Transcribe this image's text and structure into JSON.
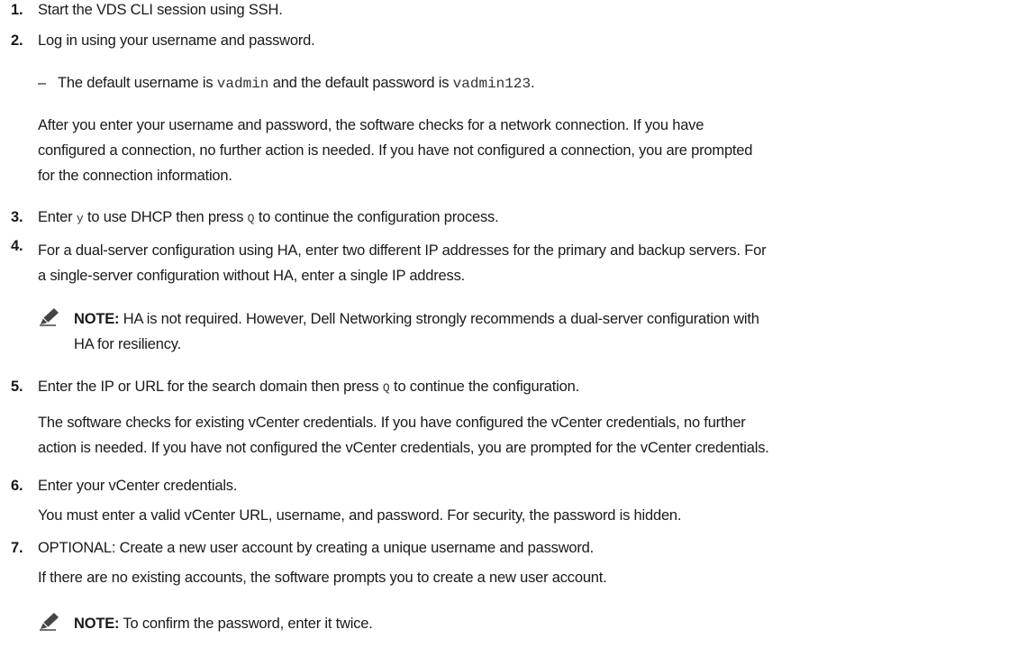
{
  "steps": [
    {
      "num": "1.",
      "text": "Start the VDS CLI session using SSH."
    },
    {
      "num": "2.",
      "text": "Log in using your username and password."
    },
    {
      "num": "3.",
      "text_a": "Enter ",
      "key_a": "y",
      "text_b": " to use DHCP then press ",
      "key_b": "Q",
      "text_c": " to continue the configuration process."
    },
    {
      "num": "4.",
      "line1": "For a dual-server configuration using HA, enter two different IP addresses for the primary and backup servers. For",
      "line2": "a single-server configuration without HA, enter a single IP address."
    },
    {
      "num": "5.",
      "text_a": "Enter the IP or URL for the search domain then press ",
      "key": "Q",
      "text_b": " to continue the configuration."
    },
    {
      "num": "6.",
      "text": "Enter your vCenter credentials."
    },
    {
      "num": "7.",
      "text": "OPTIONAL: Create a new user account by creating a unique username and password."
    }
  ],
  "step2_bullet": {
    "dash": "–",
    "text_a": "The default username is ",
    "username": "vadmin",
    "text_b": " and the default password is ",
    "password": "vadmin123",
    "text_c": "."
  },
  "step2_para": {
    "line1": "After you enter your username and password, the software checks for a network connection. If you have",
    "line2": "configured a connection, no further action is needed. If you have not configured a connection, you are prompted",
    "line3": "for the connection information."
  },
  "note1": {
    "label": "NOTE:",
    "line1": " HA is not required. However, Dell Networking strongly recommends a dual-server configuration with",
    "line2": "HA for resiliency."
  },
  "step5_para": {
    "line1": "The software checks for existing vCenter credentials. If you have configured the vCenter credentials, no further",
    "line2": "action is needed. If you have not configured the vCenter credentials, you are prompted for the vCenter credentials."
  },
  "step6_para": "You must enter a valid vCenter URL, username, and password. For security, the password is hidden.",
  "step7_para": "If there are no existing accounts, the software prompts you to create a new user account.",
  "note2": {
    "label": "NOTE:",
    "text": " To confirm the password, enter it twice."
  },
  "colors": {
    "text": "#1a1a1a",
    "note_icon": "#333333"
  },
  "icons": {
    "note": "pencil-note-icon"
  }
}
